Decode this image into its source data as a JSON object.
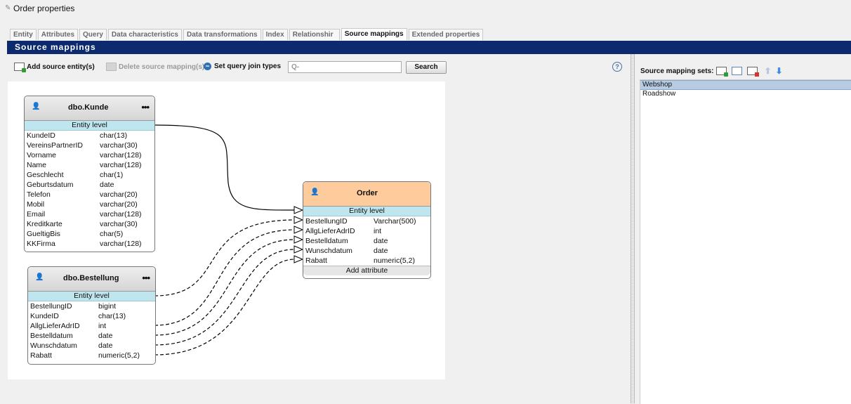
{
  "window": {
    "title": "Order properties"
  },
  "tabs": [
    {
      "label": "Entity",
      "active": false
    },
    {
      "label": "Attributes",
      "active": false
    },
    {
      "label": "Query",
      "active": false
    },
    {
      "label": "Data characteristics",
      "active": false
    },
    {
      "label": "Data transformations",
      "active": false
    },
    {
      "label": "Index",
      "active": false
    },
    {
      "label": "Relationshir",
      "active": false
    },
    {
      "label": "Source mappings",
      "active": true
    },
    {
      "label": "Extended properties",
      "active": false
    }
  ],
  "section": {
    "title": "Source mappings"
  },
  "toolbar": {
    "add_source": "Add source entity(s)",
    "delete_mapping": "Delete source mapping(s)",
    "set_join": "Set query join types",
    "search_placeholder": "Q-",
    "search_button": "Search",
    "help": "?"
  },
  "entities": {
    "kunde": {
      "name": "dbo.Kunde",
      "level": "Entity  level",
      "attributes": [
        {
          "name": "KundeID",
          "type": "char(13)"
        },
        {
          "name": "VereinsPartnerID",
          "type": "varchar(30)"
        },
        {
          "name": "Vorname",
          "type": "varchar(128)"
        },
        {
          "name": "Name",
          "type": "varchar(128)"
        },
        {
          "name": "Geschlecht",
          "type": "char(1)"
        },
        {
          "name": "Geburtsdatum",
          "type": "date"
        },
        {
          "name": "Telefon",
          "type": "varchar(20)"
        },
        {
          "name": "Mobil",
          "type": "varchar(20)"
        },
        {
          "name": "Email",
          "type": "varchar(128)"
        },
        {
          "name": "Kreditkarte",
          "type": "varchar(30)"
        },
        {
          "name": "GueltigBis",
          "type": "char(5)"
        },
        {
          "name": "KKFirma",
          "type": "varchar(128)"
        }
      ]
    },
    "bestellung": {
      "name": "dbo.Bestellung",
      "level": "Entity  level",
      "attributes": [
        {
          "name": "BestellungID",
          "type": "bigint"
        },
        {
          "name": "KundeID",
          "type": "char(13)"
        },
        {
          "name": "AllgLieferAdrID",
          "type": "int"
        },
        {
          "name": "Bestelldatum",
          "type": "date"
        },
        {
          "name": "Wunschdatum",
          "type": "date"
        },
        {
          "name": "Rabatt",
          "type": "numeric(5,2)"
        }
      ]
    },
    "order": {
      "name": "Order",
      "level": "Entity  level",
      "attributes": [
        {
          "name": "BestellungID",
          "type": "Varchar(500)"
        },
        {
          "name": "AllgLieferAdrID",
          "type": "int"
        },
        {
          "name": "Bestelldatum",
          "type": "date"
        },
        {
          "name": "Wunschdatum",
          "type": "date"
        },
        {
          "name": "Rabatt",
          "type": "numeric(5,2)"
        }
      ],
      "add_attribute": "Add attribute"
    }
  },
  "right_panel": {
    "label": "Source mapping sets:",
    "sets": [
      {
        "label": "Webshop",
        "selected": true
      },
      {
        "label": "Roadshow",
        "selected": false
      }
    ]
  },
  "colors": {
    "section_header": "#0d2a6e",
    "source_header": "#d5d5d5",
    "target_header": "#fdcb9c",
    "level_band": "#bfe6ee",
    "selected_row": "#b7cbe3"
  }
}
